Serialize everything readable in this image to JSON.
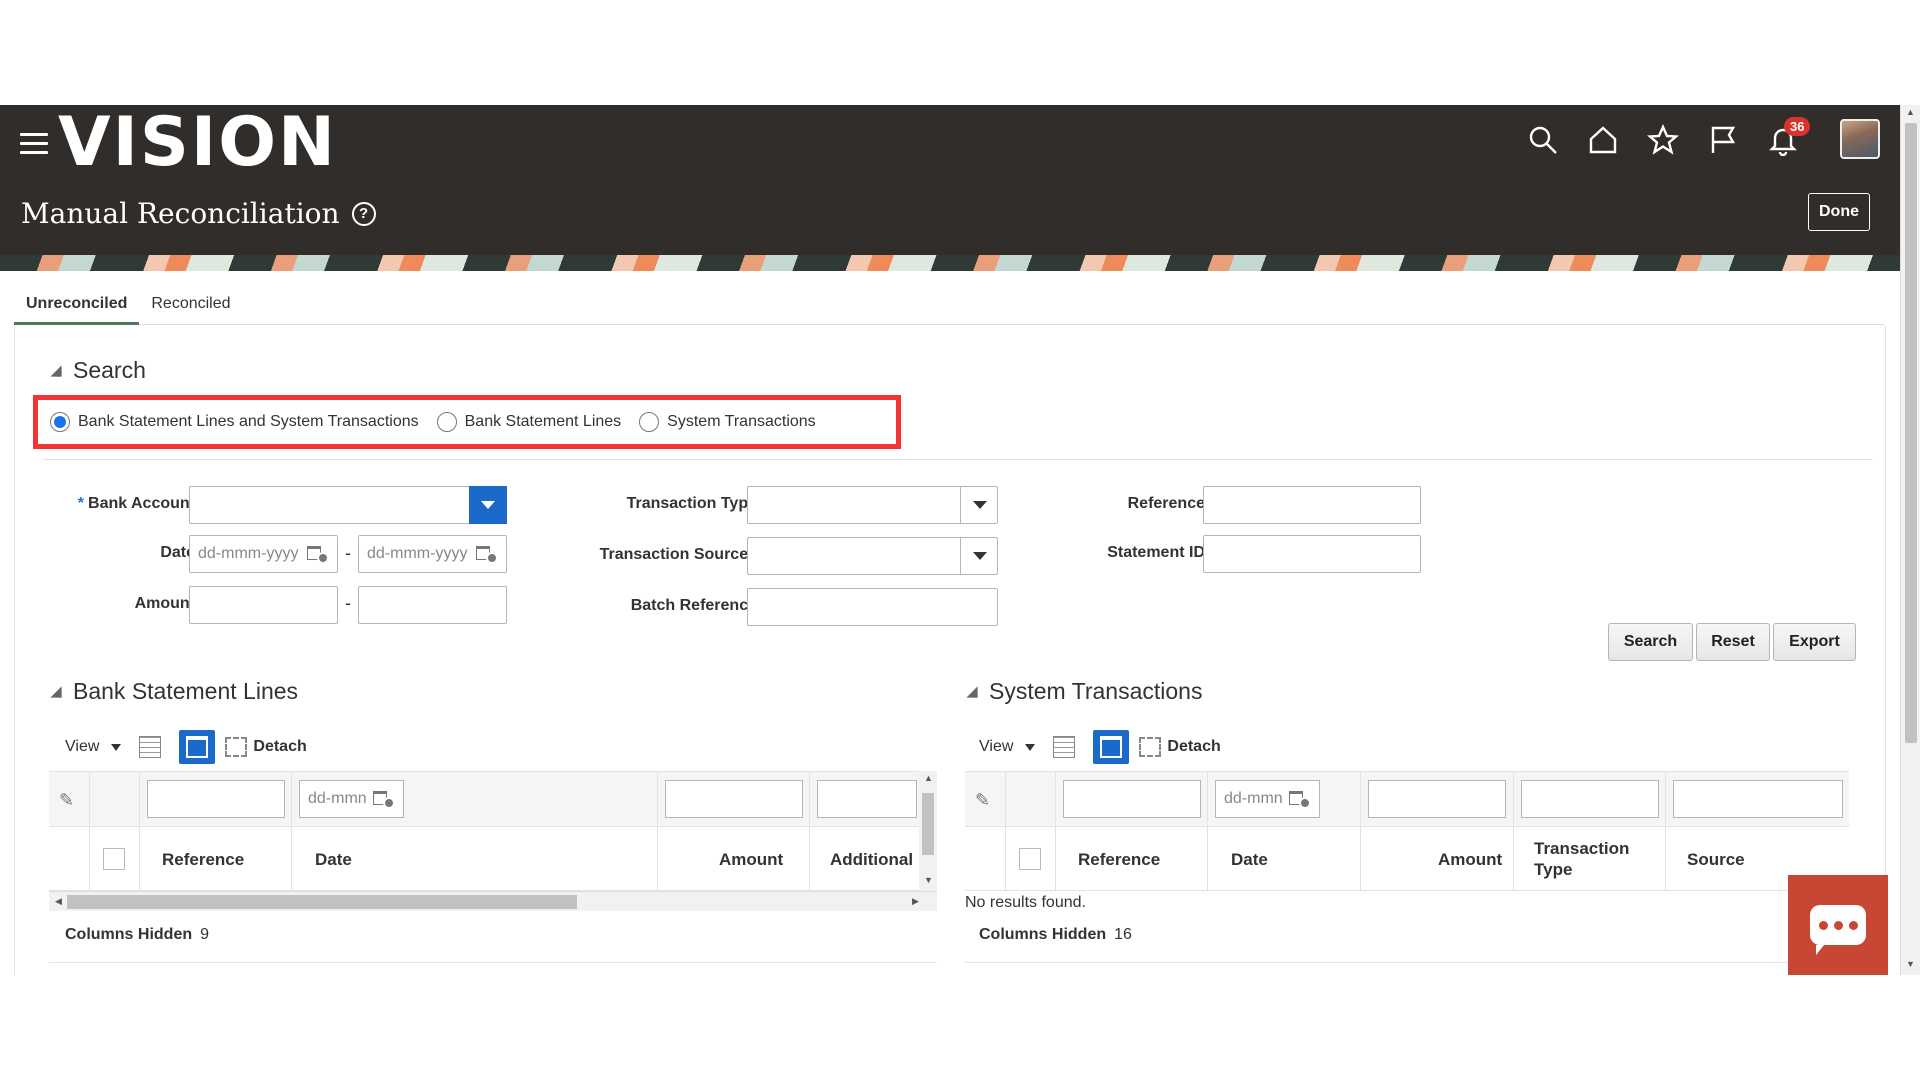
{
  "header": {
    "logo": "VISION",
    "page_title": "Manual Reconciliation",
    "help_glyph": "?",
    "done_label": "Done",
    "notification_count": "36",
    "icons": [
      "search-icon",
      "home-icon",
      "star-icon",
      "flag-icon",
      "bell-icon"
    ]
  },
  "tabs": [
    {
      "label": "Unreconciled",
      "active": true
    },
    {
      "label": "Reconciled",
      "active": false
    }
  ],
  "search": {
    "title": "Search",
    "radios": [
      {
        "label": "Bank Statement Lines and System Transactions",
        "checked": true
      },
      {
        "label": "Bank Statement Lines",
        "checked": false
      },
      {
        "label": "System Transactions",
        "checked": false
      }
    ],
    "fields": {
      "required_mark": "*",
      "bank_account": "Bank Account",
      "date": "Date",
      "amount": "Amount",
      "transaction_type": "Transaction Type",
      "transaction_sources": "Transaction Sources",
      "batch_reference": "Batch Reference",
      "reference": "Reference",
      "statement_id": "Statement ID",
      "date_placeholder": "dd-mmm-yyyy",
      "range_sep": "-"
    },
    "buttons": {
      "search": "Search",
      "reset": "Reset",
      "export": "Export"
    }
  },
  "bank_statement_lines": {
    "title": "Bank Statement Lines",
    "toolbar": {
      "view": "View",
      "detach": "Detach"
    },
    "filter_date_placeholder": "dd-mmn",
    "columns": [
      "Reference",
      "Date",
      "Amount",
      "Additional I"
    ],
    "footer_label": "Columns Hidden",
    "footer_count": "9"
  },
  "system_transactions": {
    "title": "System Transactions",
    "toolbar": {
      "view": "View",
      "detach": "Detach"
    },
    "filter_date_placeholder": "dd-mmn",
    "columns": [
      "Reference",
      "Date",
      "Amount",
      "Transaction Type",
      "Source"
    ],
    "empty_text": "No results found.",
    "footer_label": "Columns Hidden",
    "footer_count": "16"
  },
  "colors": {
    "header_bg": "#312d2a",
    "accent_blue": "#1b6ac9",
    "highlight_red": "#f23434",
    "chat_red": "#c74634"
  }
}
